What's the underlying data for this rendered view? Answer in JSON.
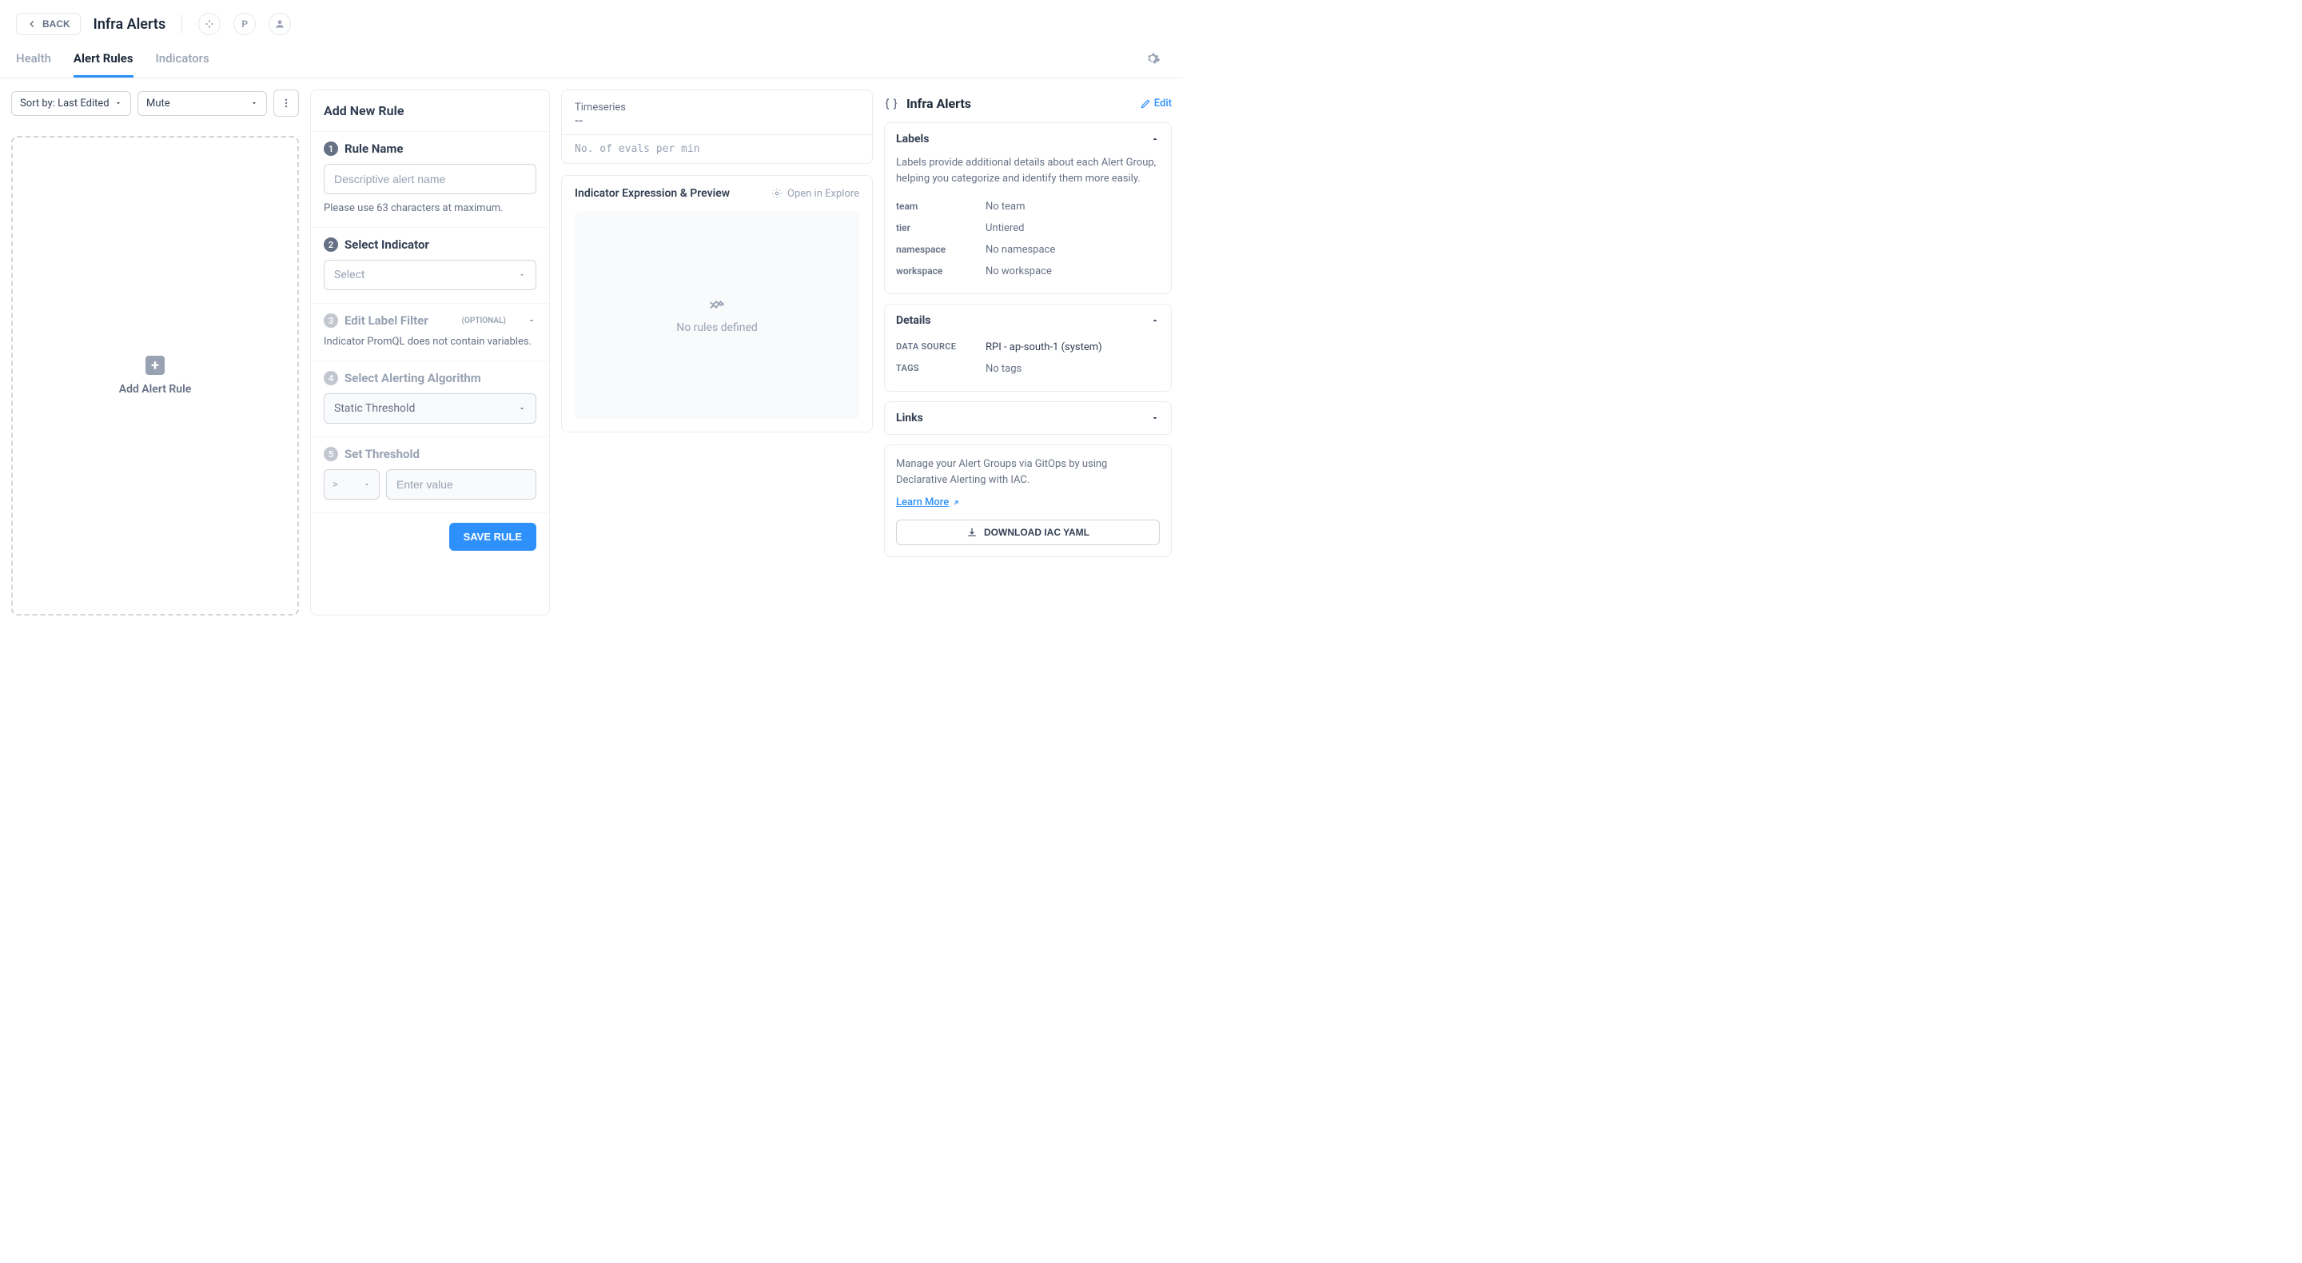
{
  "header": {
    "back": "BACK",
    "title": "Infra Alerts"
  },
  "tabs": {
    "health": "Health",
    "alert_rules": "Alert Rules",
    "indicators": "Indicators"
  },
  "col1": {
    "sort_label": "Sort by: Last Edited",
    "mute": "Mute",
    "add_rule": "Add Alert Rule"
  },
  "form": {
    "panel_title": "Add New Rule",
    "step1": {
      "title": "Rule Name",
      "placeholder": "Descriptive alert name",
      "helper": "Please use 63 characters at maximum."
    },
    "step2": {
      "title": "Select Indicator",
      "placeholder": "Select"
    },
    "step3": {
      "title": "Edit Label Filter",
      "optional": "(OPTIONAL)",
      "helper": "Indicator PromQL does not contain variables."
    },
    "step4": {
      "title": "Select Alerting Algorithm",
      "value": "Static Threshold"
    },
    "step5": {
      "title": "Set Threshold",
      "op": ">",
      "placeholder": "Enter value"
    },
    "save": "SAVE RULE"
  },
  "preview": {
    "ts_label": "Timeseries",
    "ts_value": "--",
    "evals": "No. of evals per min",
    "expr_title": "Indicator Expression & Preview",
    "open_explore": "Open in Explore",
    "empty": "No rules defined"
  },
  "right": {
    "title": "Infra Alerts",
    "edit": "Edit",
    "labels": {
      "title": "Labels",
      "desc": "Labels provide additional details about each Alert Group, helping you categorize and identify them more easily.",
      "rows": {
        "team_k": "team",
        "team_v": "No team",
        "tier_k": "tier",
        "tier_v": "Untiered",
        "ns_k": "namespace",
        "ns_v": "No namespace",
        "ws_k": "workspace",
        "ws_v": "No workspace"
      }
    },
    "details": {
      "title": "Details",
      "rows": {
        "ds_k": "DATA SOURCE",
        "ds_v": "RPI - ap-south-1 (system)",
        "tags_k": "TAGS",
        "tags_v": "No tags"
      }
    },
    "links": {
      "title": "Links"
    },
    "gitops": {
      "desc": "Manage your Alert Groups via GitOps by using Declarative Alerting with IAC.",
      "learn": "Learn More",
      "download": "DOWNLOAD IAC YAML"
    }
  }
}
